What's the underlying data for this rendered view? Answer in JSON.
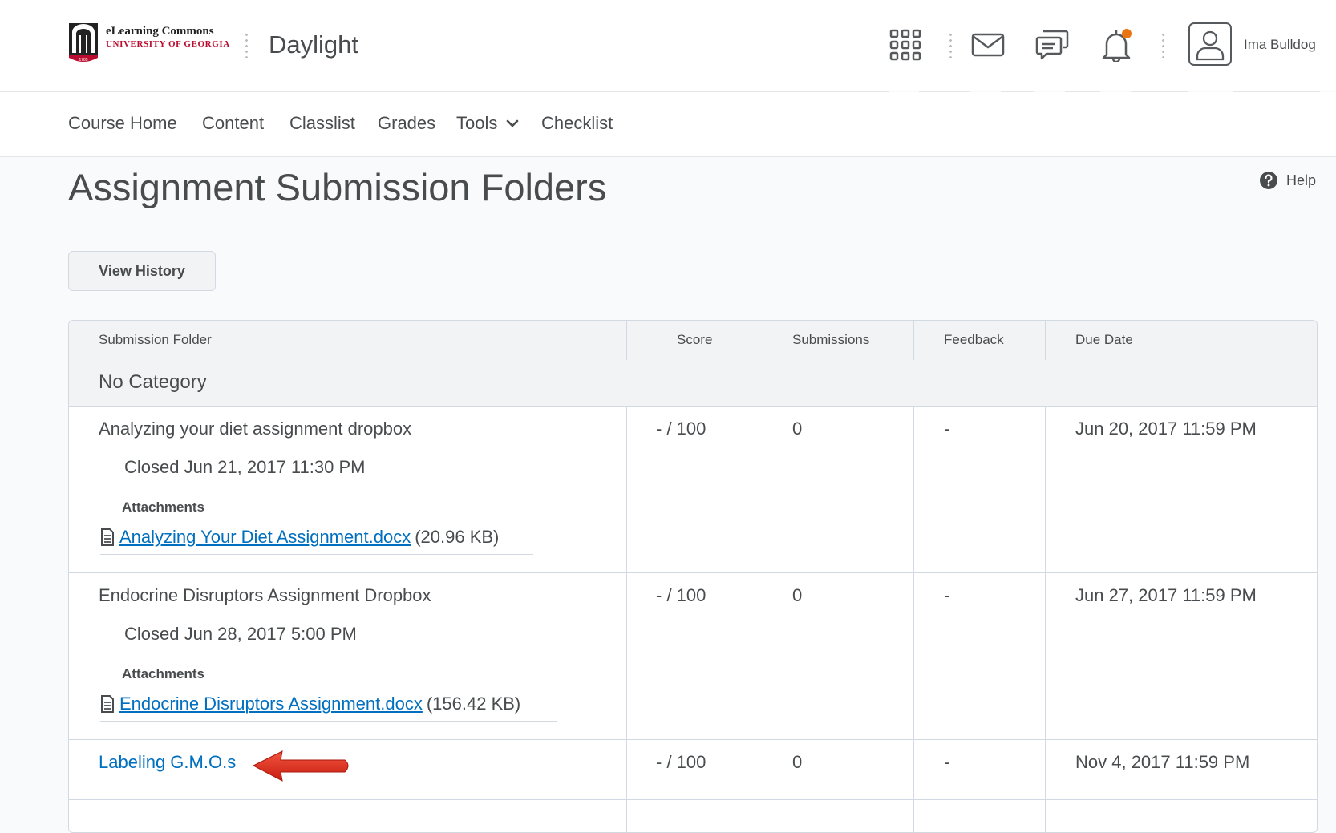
{
  "header": {
    "logo": {
      "line1": "eLearning Commons",
      "line2": "UNIVERSITY OF GEORGIA",
      "seal_text": "1785"
    },
    "app_title": "Daylight",
    "icons": [
      "apps-grid-icon",
      "mail-icon",
      "chat-icon",
      "bell-icon"
    ],
    "notification_dot_color": "#e87511",
    "user_name": "Ima Bulldog"
  },
  "nav": {
    "items": [
      "Course Home",
      "Content",
      "Classlist",
      "Grades",
      "Tools",
      "Checklist"
    ]
  },
  "page": {
    "title": "Assignment Submission Folders",
    "help_label": "Help",
    "view_history_label": "View History"
  },
  "table": {
    "columns": [
      "Submission Folder",
      "Score",
      "Submissions",
      "Feedback",
      "Due Date"
    ],
    "category": "No Category",
    "rows": [
      {
        "name": "Analyzing your diet assignment dropbox",
        "closed": "Closed Jun 21, 2017 11:30 PM",
        "attachments_label": "Attachments",
        "attachment_name": "Analyzing Your Diet Assignment.docx",
        "attachment_size": "(20.96 KB)",
        "score": "- / 100",
        "submissions": "0",
        "feedback": "-",
        "due": "Jun 20, 2017 11:59 PM"
      },
      {
        "name": "Endocrine Disruptors Assignment Dropbox",
        "closed": "Closed Jun 28, 2017 5:00 PM",
        "attachments_label": "Attachments",
        "attachment_name": "Endocrine Disruptors Assignment.docx",
        "attachment_size": "(156.42 KB)",
        "score": "- / 100",
        "submissions": "0",
        "feedback": "-",
        "due": "Jun 27, 2017 11:59 PM"
      },
      {
        "name": "Labeling G.M.O.s",
        "score": "- / 100",
        "submissions": "0",
        "feedback": "-",
        "due": "Nov 4, 2017 11:59 PM"
      }
    ]
  },
  "colors": {
    "text": "#494c4e",
    "link": "#006fbf",
    "border": "#d3d9e3",
    "header_bg": "#f1f3f5",
    "brand_red": "#ba0c2f",
    "annotation_arrow": "#e2321f"
  }
}
